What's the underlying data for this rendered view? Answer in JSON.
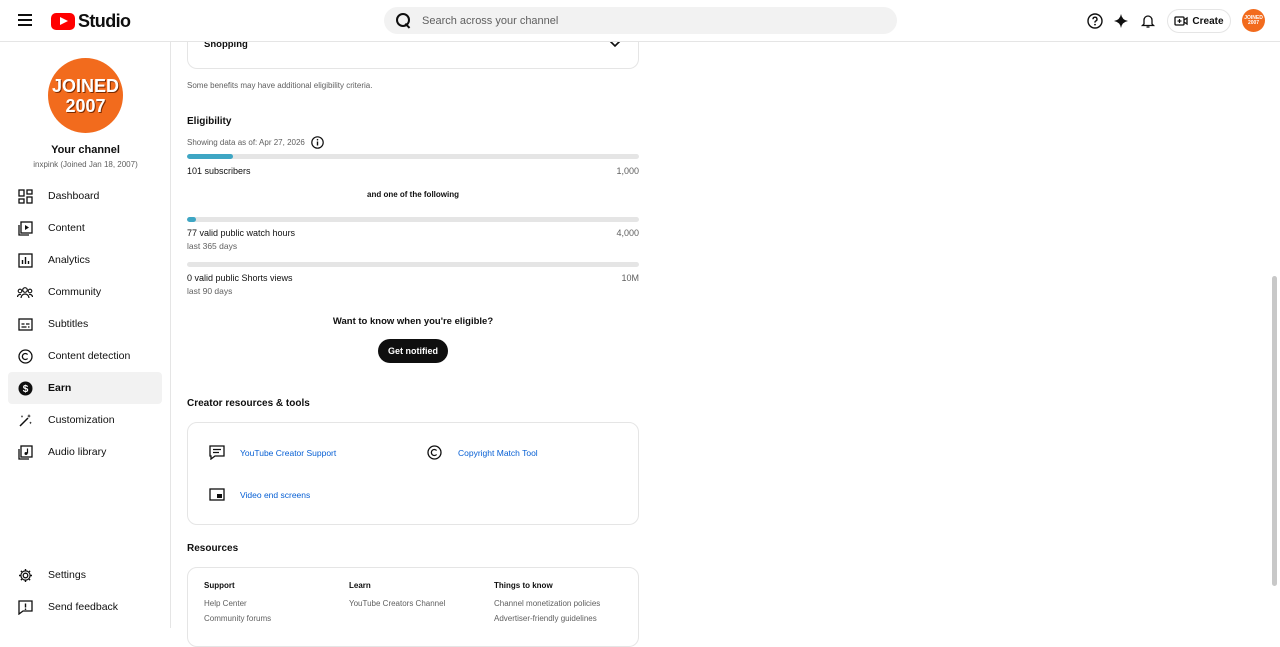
{
  "header": {
    "studio_label": "Studio",
    "search_placeholder": "Search across your channel",
    "create_label": "Create",
    "avatar_text": "JOINED 2007"
  },
  "sidebar": {
    "avatar_line1": "JOINED",
    "avatar_line2": "2007",
    "channel_title": "Your channel",
    "channel_sub": "inxpink (Joined Jan 18, 2007)",
    "items": [
      {
        "label": "Dashboard",
        "icon": "dashboard-icon"
      },
      {
        "label": "Content",
        "icon": "content-icon"
      },
      {
        "label": "Analytics",
        "icon": "analytics-icon"
      },
      {
        "label": "Community",
        "icon": "community-icon"
      },
      {
        "label": "Subtitles",
        "icon": "subtitles-icon"
      },
      {
        "label": "Content detection",
        "icon": "copyright-icon"
      },
      {
        "label": "Earn",
        "icon": "dollar-icon",
        "active": true
      },
      {
        "label": "Customization",
        "icon": "magic-wand-icon"
      },
      {
        "label": "Audio library",
        "icon": "audio-library-icon"
      }
    ],
    "bottom_items": [
      {
        "label": "Settings",
        "icon": "gear-icon"
      },
      {
        "label": "Send feedback",
        "icon": "feedback-icon"
      }
    ]
  },
  "main": {
    "shopping_label": "Shopping",
    "benefits_note": "Some benefits may have additional eligibility criteria.",
    "eligibility": {
      "title": "Eligibility",
      "as_of": "Showing data as of: Apr 27, 2026",
      "subscribers": {
        "label": "101 subscribers",
        "target": "1,000",
        "progress": 0.101
      },
      "and_one": "and one of the following",
      "watch_hours": {
        "label": "77 valid public watch hours",
        "sub": "last 365 days",
        "target": "4,000",
        "progress": 0.019
      },
      "shorts": {
        "label": "0 valid public Shorts views",
        "sub": "last 90 days",
        "target": "10M",
        "progress": 0
      },
      "want_to_know": "Want to know when you're eligible?",
      "get_notified": "Get notified"
    },
    "creator_tools": {
      "title": "Creator resources & tools",
      "items": [
        {
          "label": "YouTube Creator Support",
          "icon": "chat-icon"
        },
        {
          "label": "Copyright Match Tool",
          "icon": "copyright-icon"
        },
        {
          "label": "Video end screens",
          "icon": "end-screen-icon"
        }
      ]
    },
    "resources": {
      "title": "Resources",
      "columns": [
        {
          "head": "Support",
          "items": [
            "Help Center",
            "Community forums"
          ]
        },
        {
          "head": "Learn",
          "items": [
            "YouTube Creators Channel"
          ]
        },
        {
          "head": "Things to know",
          "items": [
            "Channel monetization policies",
            "Advertiser-friendly guidelines"
          ]
        }
      ]
    }
  },
  "colors": {
    "accent": "#3ea6c4",
    "brand": "#ff0000",
    "avatar": "#f26b1d",
    "link": "#065fd4"
  }
}
